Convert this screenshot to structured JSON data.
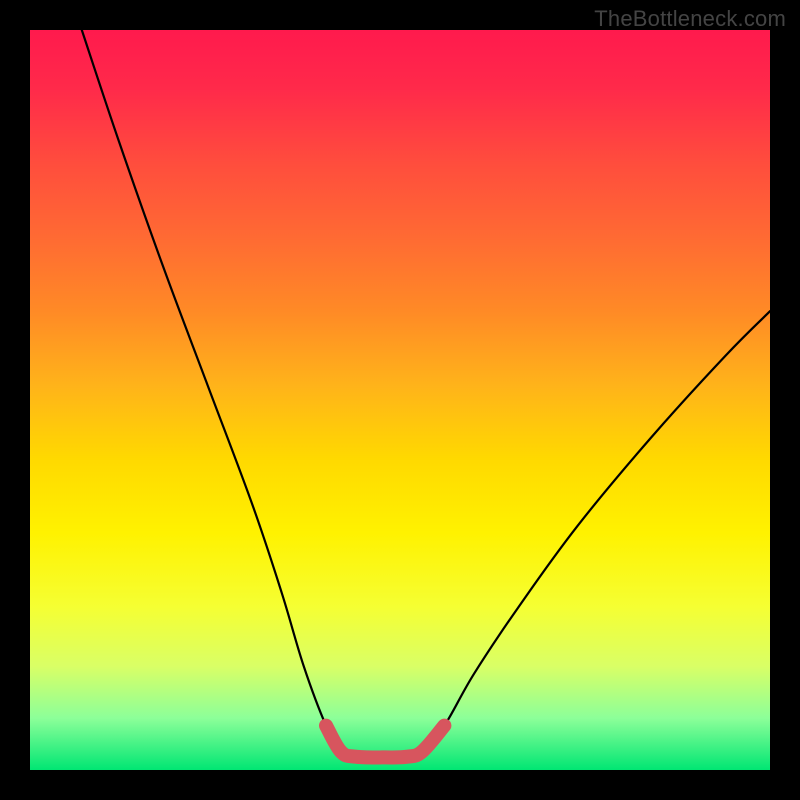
{
  "watermark": "TheBottleneck.com",
  "chart_data": {
    "type": "line",
    "title": "",
    "xlabel": "",
    "ylabel": "",
    "x_range": [
      0,
      100
    ],
    "y_range": [
      0,
      100
    ],
    "series": [
      {
        "name": "black-curve",
        "color": "#000000",
        "points": [
          {
            "x": 7,
            "y": 100
          },
          {
            "x": 12,
            "y": 85
          },
          {
            "x": 18,
            "y": 68
          },
          {
            "x": 24,
            "y": 52
          },
          {
            "x": 30,
            "y": 36
          },
          {
            "x": 34,
            "y": 24
          },
          {
            "x": 37,
            "y": 14
          },
          {
            "x": 40,
            "y": 6
          },
          {
            "x": 42,
            "y": 2.5
          },
          {
            "x": 44,
            "y": 1.8
          },
          {
            "x": 48,
            "y": 1.7
          },
          {
            "x": 51,
            "y": 1.8
          },
          {
            "x": 53,
            "y": 2.5
          },
          {
            "x": 56,
            "y": 6
          },
          {
            "x": 60,
            "y": 13
          },
          {
            "x": 66,
            "y": 22
          },
          {
            "x": 74,
            "y": 33
          },
          {
            "x": 84,
            "y": 45
          },
          {
            "x": 94,
            "y": 56
          },
          {
            "x": 100,
            "y": 62
          }
        ]
      },
      {
        "name": "red-trough-overlay",
        "color": "#d7555e",
        "points": [
          {
            "x": 40,
            "y": 6
          },
          {
            "x": 42,
            "y": 2.5
          },
          {
            "x": 44,
            "y": 1.8
          },
          {
            "x": 48,
            "y": 1.7
          },
          {
            "x": 51,
            "y": 1.8
          },
          {
            "x": 53,
            "y": 2.5
          },
          {
            "x": 56,
            "y": 6
          }
        ]
      }
    ]
  }
}
